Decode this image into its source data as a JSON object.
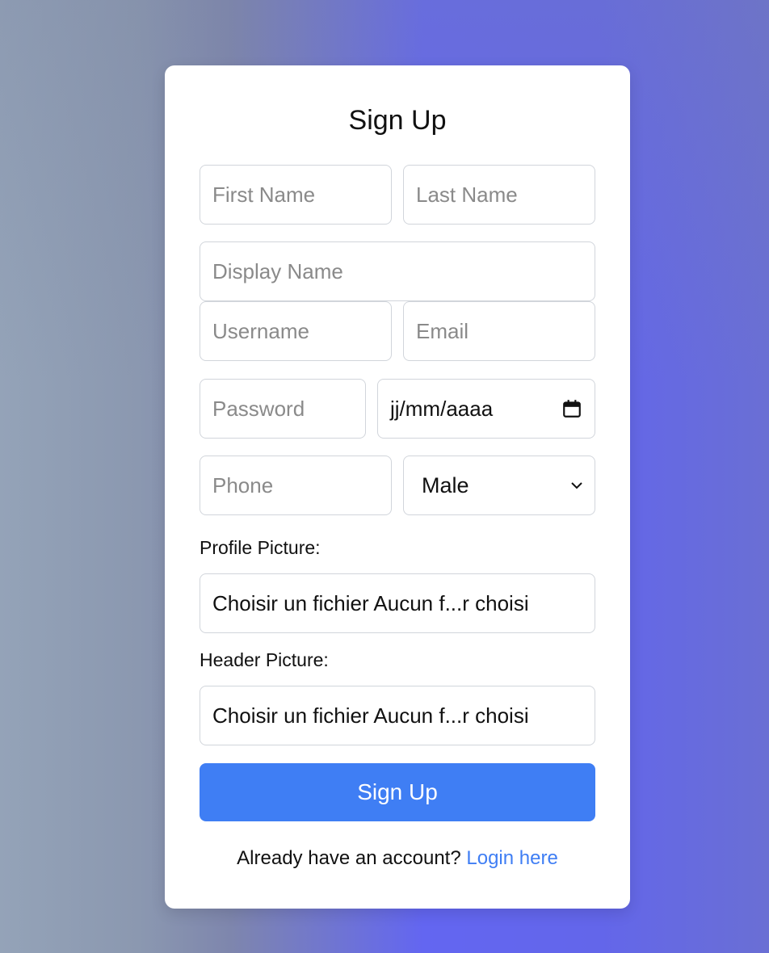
{
  "form": {
    "title": "Sign Up",
    "first_name_placeholder": "First Name",
    "last_name_placeholder": "Last Name",
    "display_name_placeholder": "Display Name",
    "username_placeholder": "Username",
    "email_placeholder": "Email",
    "password_placeholder": "Password",
    "birthdate_value": "jj/mm/aaaa",
    "phone_placeholder": "Phone",
    "gender_selected": "Male",
    "profile_picture_label": "Profile Picture:",
    "profile_picture_value": "Choisir un fichier Aucun f...r choisi",
    "header_picture_label": "Header Picture:",
    "header_picture_value": "Choisir un fichier Aucun f...r choisi",
    "submit_label": "Sign Up",
    "footer_text": "Already have an account?",
    "login_link": "Login here"
  },
  "colors": {
    "primary": "#3f7ef4",
    "card_bg": "#ffffff",
    "border": "#d1d5db"
  },
  "icons": {
    "calendar": "calendar-icon",
    "select_arrow": "chevron-down-icon"
  }
}
